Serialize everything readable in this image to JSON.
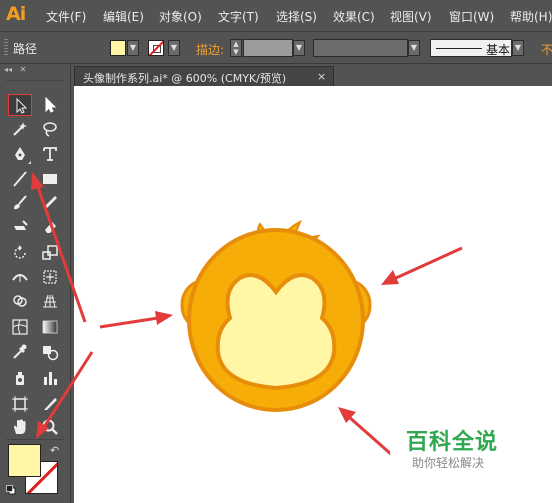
{
  "app": {
    "logo": "Ai"
  },
  "menu": [
    "文件(F)",
    "编辑(E)",
    "对象(O)",
    "文字(T)",
    "选择(S)",
    "效果(C)",
    "视图(V)",
    "窗口(W)",
    "帮助(H)"
  ],
  "control_bar": {
    "selection_label": "路径",
    "fill_color": "#fff7a6",
    "stroke_label": "描边:",
    "brush_label": "基本",
    "cutoff_label": "不"
  },
  "document": {
    "tab_title": "头像制作系列.ai* @ 600% (CMYK/预览)",
    "close_glyph": "×"
  },
  "toolbox": {
    "fill_color": "#fff7a6",
    "stroke_color": "none",
    "selected_tool": "selection-tool"
  },
  "colors": {
    "face_outer": "#f6ad07",
    "face_outline": "#e88d0b",
    "face_inner": "#fff7a6",
    "hair": "#f6ad07",
    "annotation_arrow": "#e23b3b"
  },
  "watermark": {
    "title": "百科全说",
    "subtitle": "助你轻松解决"
  }
}
